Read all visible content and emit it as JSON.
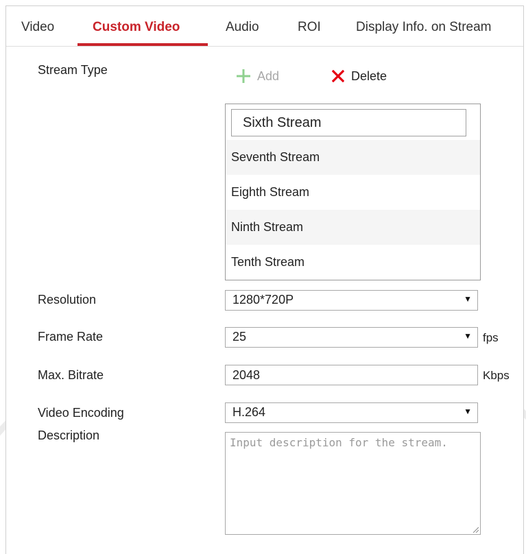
{
  "tabs": [
    {
      "label": "Video"
    },
    {
      "label": "Custom Video"
    },
    {
      "label": "Audio"
    },
    {
      "label": "ROI"
    },
    {
      "label": "Display Info. on Stream"
    }
  ],
  "stream_type": {
    "label": "Stream Type",
    "add_label": "Add",
    "delete_label": "Delete",
    "selected_input": "Sixth Stream",
    "items": [
      "Seventh Stream",
      "Eighth Stream",
      "Ninth Stream",
      "Tenth Stream"
    ]
  },
  "resolution": {
    "label": "Resolution",
    "value": "1280*720P"
  },
  "frame_rate": {
    "label": "Frame Rate",
    "value": "25",
    "unit": "fps"
  },
  "max_bitrate": {
    "label": "Max. Bitrate",
    "value": "2048",
    "unit": "Kbps"
  },
  "video_encoding": {
    "label": "Video Encoding",
    "value": "H.264"
  },
  "description": {
    "label": "Description",
    "placeholder": "Input description for the stream."
  },
  "colors": {
    "accent": "#c9242b",
    "add_icon": "#8fd18f",
    "delete_icon": "#e60012"
  }
}
